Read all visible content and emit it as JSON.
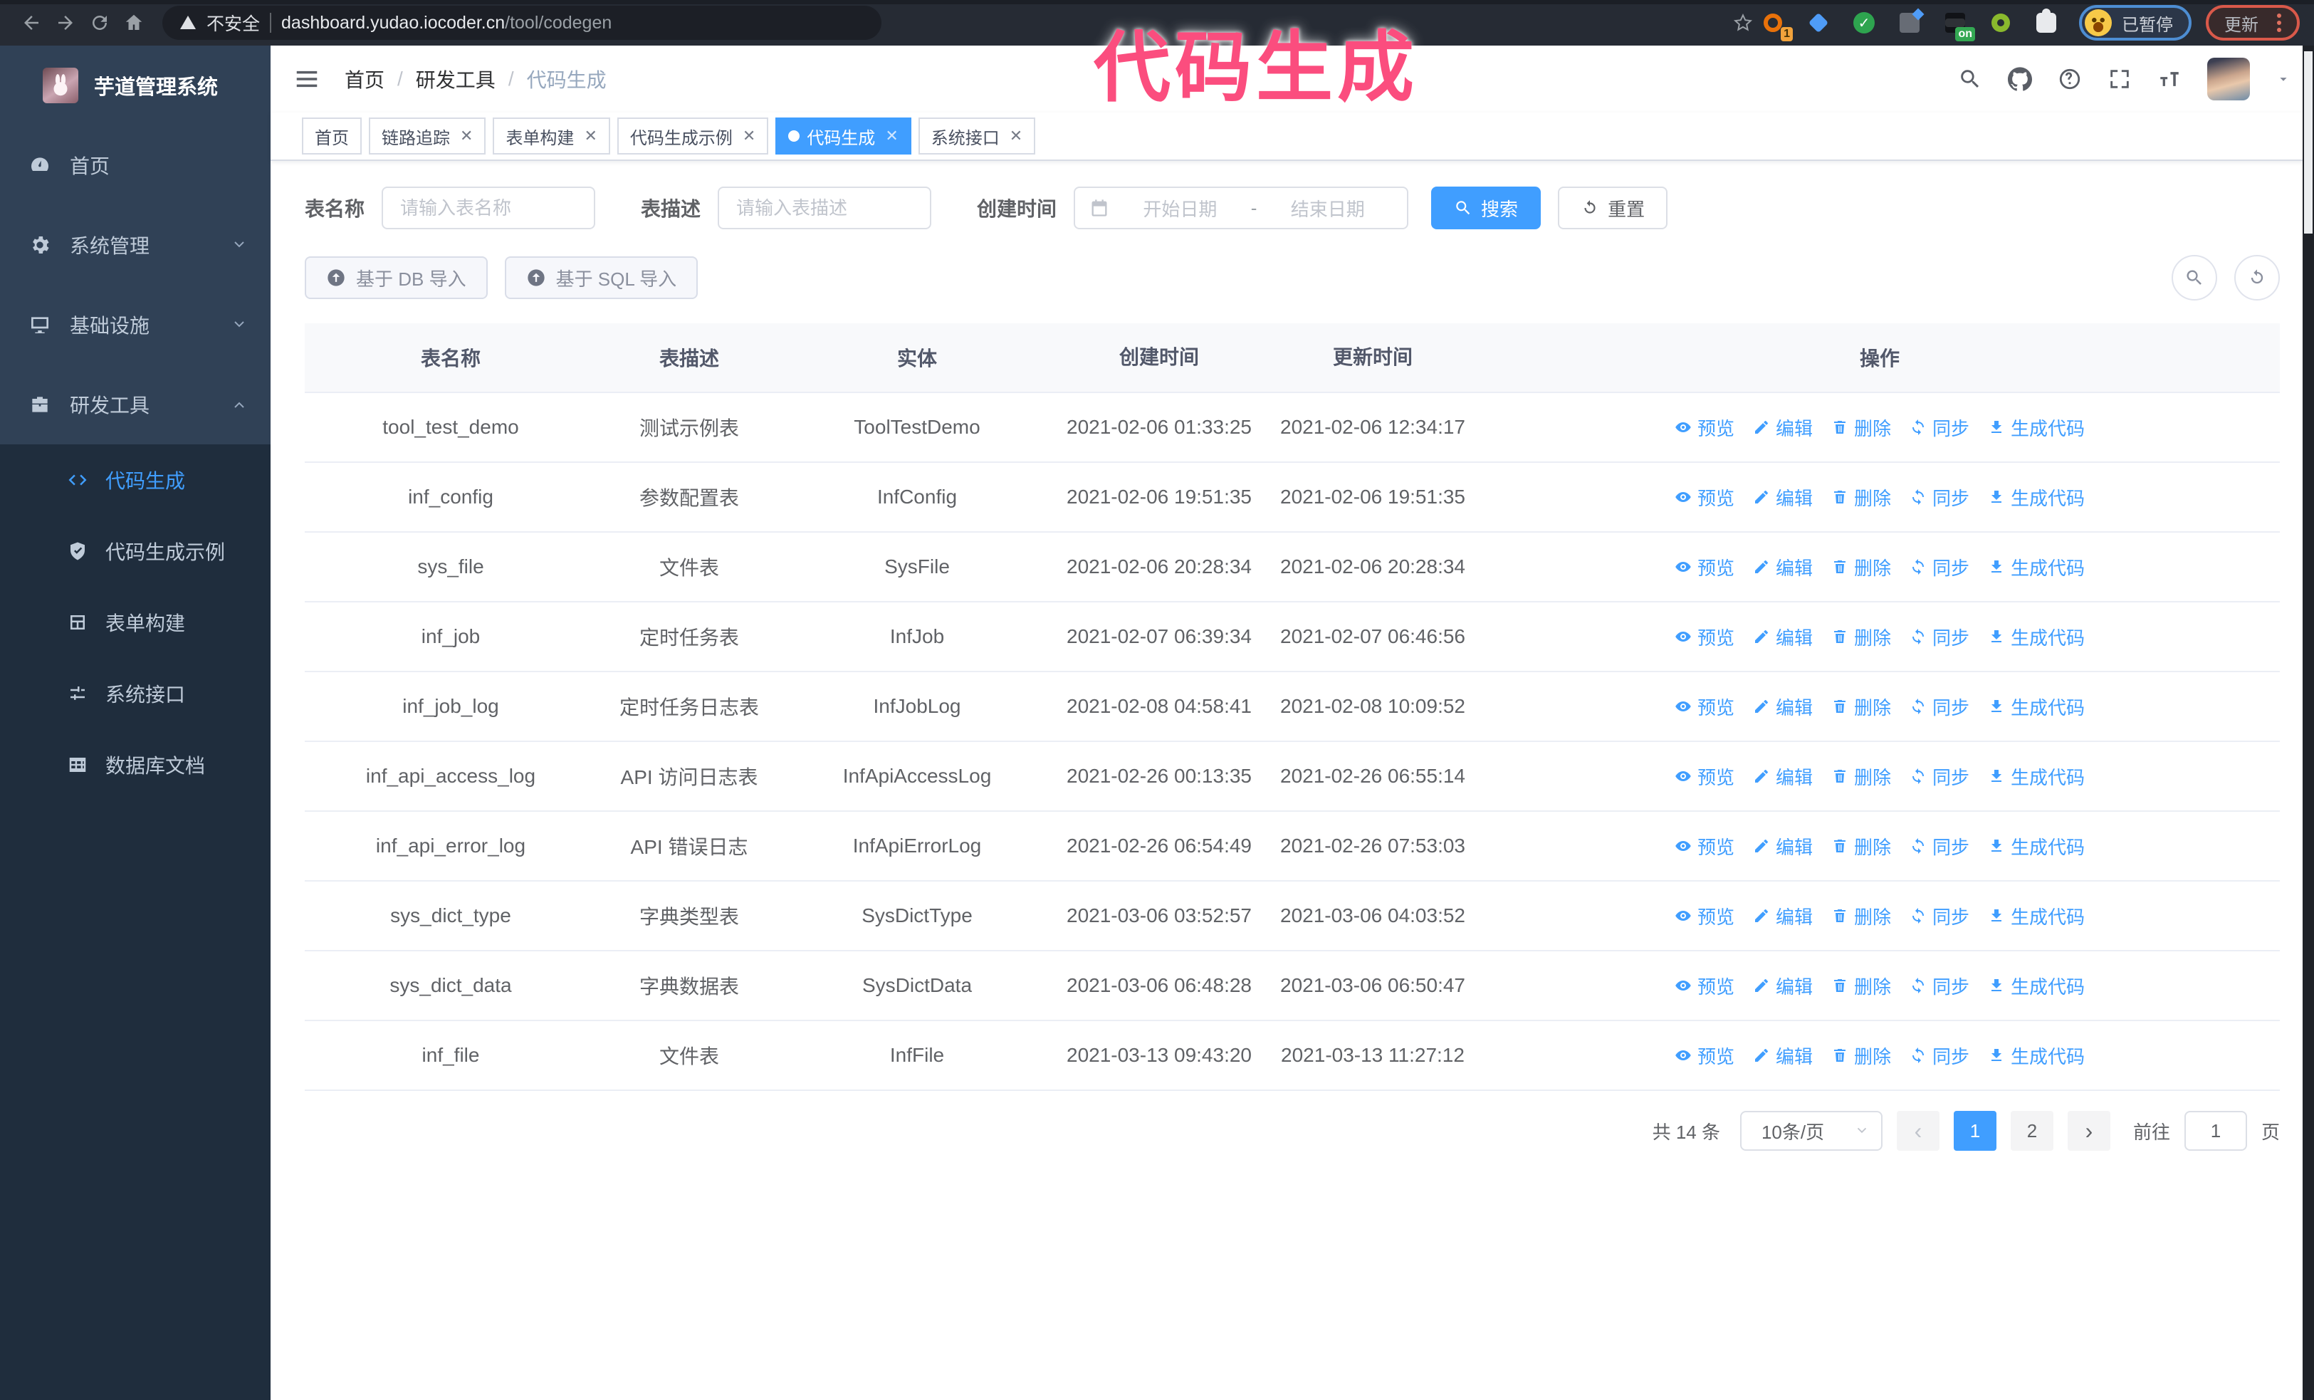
{
  "browser": {
    "security_label": "不安全",
    "url_host": "dashboard.yudao.iocoder.cn",
    "url_path": "/tool/codegen",
    "profile_status": "已暂停",
    "update_label": "更新",
    "extensions": [
      {
        "icon": "history-ring-icon",
        "badge": "1"
      },
      {
        "icon": "gem-icon"
      },
      {
        "icon": "check-shield-icon"
      },
      {
        "icon": "columns-icon"
      },
      {
        "icon": "database-icon",
        "badge": "on"
      },
      {
        "icon": "key-icon"
      },
      {
        "icon": "puzzle-icon"
      }
    ]
  },
  "overlay_title": "代码生成",
  "sidebar": {
    "app_title": "芋道管理系统",
    "items": [
      {
        "label": "首页",
        "icon": "dashboard-icon",
        "expandable": false
      },
      {
        "label": "系统管理",
        "icon": "gear-icon",
        "expandable": true,
        "expanded": false
      },
      {
        "label": "基础设施",
        "icon": "monitor-icon",
        "expandable": true,
        "expanded": false
      },
      {
        "label": "研发工具",
        "icon": "toolbox-icon",
        "expandable": true,
        "expanded": true
      }
    ],
    "submenu": [
      {
        "label": "代码生成",
        "icon": "code-icon",
        "active": true
      },
      {
        "label": "代码生成示例",
        "icon": "shield-check-icon",
        "active": false
      },
      {
        "label": "表单构建",
        "icon": "form-icon",
        "active": false
      },
      {
        "label": "系统接口",
        "icon": "sliders-icon",
        "active": false
      },
      {
        "label": "数据库文档",
        "icon": "table-grid-icon",
        "active": false
      }
    ]
  },
  "header": {
    "breadcrumb": [
      "首页",
      "研发工具",
      "代码生成"
    ],
    "right_icons": [
      "search-icon",
      "github-icon",
      "question-icon",
      "fullscreen-icon",
      "fontsize-icon"
    ]
  },
  "tabs": [
    {
      "label": "首页",
      "closable": false,
      "active": false
    },
    {
      "label": "链路追踪",
      "closable": true,
      "active": false
    },
    {
      "label": "表单构建",
      "closable": true,
      "active": false
    },
    {
      "label": "代码生成示例",
      "closable": true,
      "active": false
    },
    {
      "label": "代码生成",
      "closable": true,
      "active": true
    },
    {
      "label": "系统接口",
      "closable": true,
      "active": false
    }
  ],
  "search": {
    "name_label": "表名称",
    "name_placeholder": "请输入表名称",
    "desc_label": "表描述",
    "desc_placeholder": "请输入表描述",
    "time_label": "创建时间",
    "start_placeholder": "开始日期",
    "range_separator": "-",
    "end_placeholder": "结束日期",
    "search_label": "搜索",
    "reset_label": "重置"
  },
  "toolbar": {
    "import_db_label": "基于 DB 导入",
    "import_sql_label": "基于 SQL 导入"
  },
  "table": {
    "headers": [
      "表名称",
      "表描述",
      "实体",
      "创建时间",
      "更新时间",
      "操作"
    ],
    "actions": [
      {
        "name": "preview",
        "label": "预览",
        "icon": "eye-icon"
      },
      {
        "name": "edit",
        "label": "编辑",
        "icon": "edit-icon"
      },
      {
        "name": "delete",
        "label": "删除",
        "icon": "delete-icon"
      },
      {
        "name": "sync",
        "label": "同步",
        "icon": "sync-icon"
      },
      {
        "name": "generate-code",
        "label": "生成代码",
        "icon": "download-icon"
      }
    ],
    "rows": [
      {
        "name": "tool_test_demo",
        "desc": "测试示例表",
        "entity": "ToolTestDemo",
        "created": "2021-02-06 01:33:25",
        "updated": "2021-02-06 12:34:17"
      },
      {
        "name": "inf_config",
        "desc": "参数配置表",
        "entity": "InfConfig",
        "created": "2021-02-06 19:51:35",
        "updated": "2021-02-06 19:51:35"
      },
      {
        "name": "sys_file",
        "desc": "文件表",
        "entity": "SysFile",
        "created": "2021-02-06 20:28:34",
        "updated": "2021-02-06 20:28:34"
      },
      {
        "name": "inf_job",
        "desc": "定时任务表",
        "entity": "InfJob",
        "created": "2021-02-07 06:39:34",
        "updated": "2021-02-07 06:46:56"
      },
      {
        "name": "inf_job_log",
        "desc": "定时任务日志表",
        "entity": "InfJobLog",
        "created": "2021-02-08 04:58:41",
        "updated": "2021-02-08 10:09:52"
      },
      {
        "name": "inf_api_access_log",
        "desc": "API 访问日志表",
        "entity": "InfApiAccessLog",
        "created": "2021-02-26 00:13:35",
        "updated": "2021-02-26 06:55:14"
      },
      {
        "name": "inf_api_error_log",
        "desc": "API 错误日志",
        "entity": "InfApiErrorLog",
        "created": "2021-02-26 06:54:49",
        "updated": "2021-02-26 07:53:03"
      },
      {
        "name": "sys_dict_type",
        "desc": "字典类型表",
        "entity": "SysDictType",
        "created": "2021-03-06 03:52:57",
        "updated": "2021-03-06 04:03:52"
      },
      {
        "name": "sys_dict_data",
        "desc": "字典数据表",
        "entity": "SysDictData",
        "created": "2021-03-06 06:48:28",
        "updated": "2021-03-06 06:50:47"
      },
      {
        "name": "inf_file",
        "desc": "文件表",
        "entity": "InfFile",
        "created": "2021-03-13 09:43:20",
        "updated": "2021-03-13 11:27:12"
      }
    ]
  },
  "pagination": {
    "total_text": "共 14 条",
    "page_size": "10条/页",
    "pages": [
      "1",
      "2"
    ],
    "active_page": "1",
    "goto_label": "前往",
    "goto_value": "1",
    "page_unit": "页"
  },
  "colors": {
    "accent": "#409EFF",
    "sidebar_bg": "#304156",
    "submenu_bg": "#1f2d3d",
    "browser_bar_bg": "#262b34",
    "overlay_pink": "#fb4d7e",
    "update_border": "#d9594a",
    "profile_border": "#4d8dd2"
  }
}
